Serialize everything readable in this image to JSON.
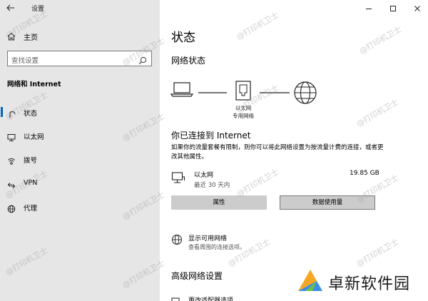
{
  "app": {
    "title": "设置"
  },
  "sidebar": {
    "home_label": "主页",
    "search_placeholder": "查找设置",
    "section_title": "网络和 Internet",
    "items": [
      {
        "label": "状态",
        "icon": "status-icon",
        "active": true
      },
      {
        "label": "以太网",
        "icon": "ethernet-icon",
        "active": false
      },
      {
        "label": "拨号",
        "icon": "dialup-icon",
        "active": false
      },
      {
        "label": "VPN",
        "icon": "vpn-icon",
        "active": false
      },
      {
        "label": "代理",
        "icon": "globe-icon",
        "active": false
      }
    ]
  },
  "main": {
    "page_title": "状态",
    "network_status_title": "网络状态",
    "diagram": {
      "label_line1": "以太网",
      "label_line2": "专用网络"
    },
    "connected_title": "你已连接到 Internet",
    "connected_desc": "如果你的流量套餐有限制，则你可以将此网络设置为按流量计费的连接，或者更改其他属性。",
    "connection": {
      "name": "以太网",
      "sub": "最近 30 天内",
      "usage": "19.85 GB"
    },
    "buttons": {
      "properties": "属性",
      "data_usage": "数据使用量"
    },
    "available": {
      "title": "显示可用网络",
      "sub": "查看周围的连接选项。"
    },
    "advanced_title": "高级网络设置",
    "advanced_first_item": "更改适配器选项"
  },
  "watermark": "@打印机卫士",
  "brand": {
    "text": "卓新软件园"
  },
  "colors": {
    "accent": "#0067c0",
    "sidebar_bg": "#e6e6e6",
    "button_bg": "#cccccc"
  }
}
